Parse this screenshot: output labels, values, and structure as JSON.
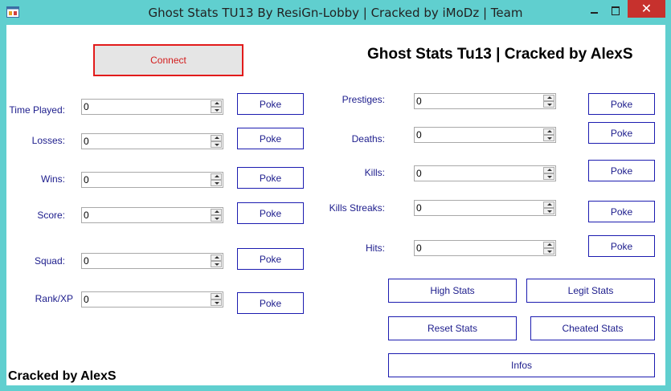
{
  "window": {
    "title": "Ghost Stats TU13 By ResiGn-Lobby | Cracked by iMoDz | Team",
    "close_glyph": "✕",
    "app_icon": "app-window-icon"
  },
  "connect_label": "Connect",
  "heading": "Ghost Stats Tu13 | Cracked by AlexS",
  "footer": "Cracked by AlexS",
  "poke_label": "Poke",
  "left_stats": [
    {
      "label": "Time Played:",
      "value": "0"
    },
    {
      "label": "Losses:",
      "value": "0"
    },
    {
      "label": "Wins:",
      "value": "0"
    },
    {
      "label": "Score:",
      "value": "0"
    },
    {
      "label": "Squad:",
      "value": "0"
    },
    {
      "label": "Rank/XP",
      "value": "0"
    }
  ],
  "right_stats": [
    {
      "label": "Prestiges:",
      "value": "0"
    },
    {
      "label": "Deaths:",
      "value": "0"
    },
    {
      "label": "Kills:",
      "value": "0"
    },
    {
      "label": "Kills Streaks:",
      "value": "0"
    },
    {
      "label": "Hits:",
      "value": "0"
    }
  ],
  "actions": {
    "high": "High Stats",
    "legit": "Legit Stats",
    "reset": "Reset Stats",
    "cheated": "Cheated Stats",
    "infos": "Infos"
  }
}
